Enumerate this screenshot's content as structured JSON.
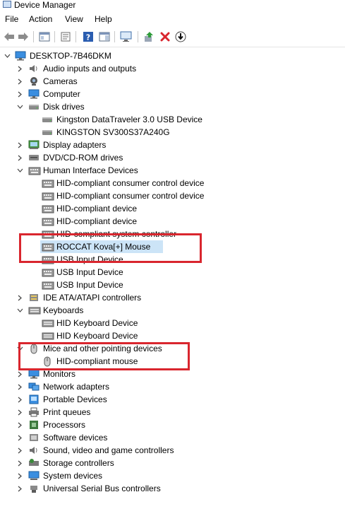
{
  "window": {
    "title": "Device Manager"
  },
  "menu": [
    "File",
    "Action",
    "View",
    "Help"
  ],
  "tree": {
    "root": "DESKTOP-7B46DKM",
    "categories": [
      {
        "label": "Audio inputs and outputs",
        "icon": "speaker-icon",
        "expanded": false,
        "children": []
      },
      {
        "label": "Cameras",
        "icon": "camera-icon",
        "expanded": false,
        "children": []
      },
      {
        "label": "Computer",
        "icon": "monitor-icon",
        "expanded": false,
        "children": []
      },
      {
        "label": "Disk drives",
        "icon": "drive-icon",
        "expanded": true,
        "children": [
          "Kingston DataTraveler 3.0 USB Device",
          "KINGSTON SV300S37A240G"
        ]
      },
      {
        "label": "Display adapters",
        "icon": "display-adapter-icon",
        "expanded": false,
        "children": []
      },
      {
        "label": "DVD/CD-ROM drives",
        "icon": "disc-icon",
        "expanded": false,
        "children": []
      },
      {
        "label": "Human Interface Devices",
        "icon": "hid-icon",
        "expanded": true,
        "children": [
          "HID-compliant consumer control device",
          "HID-compliant consumer control device",
          "HID-compliant device",
          "HID-compliant device",
          "HID-compliant system controller",
          "ROCCAT Kova[+] Mouse",
          "USB Input Device",
          "USB Input Device",
          "USB Input Device"
        ]
      },
      {
        "label": "IDE ATA/ATAPI controllers",
        "icon": "ide-icon",
        "expanded": false,
        "children": []
      },
      {
        "label": "Keyboards",
        "icon": "keyboard-icon",
        "expanded": true,
        "children": [
          "HID Keyboard Device",
          "HID Keyboard Device"
        ]
      },
      {
        "label": "Mice and other pointing devices",
        "icon": "mouse-icon",
        "expanded": true,
        "children": [
          "HID-compliant mouse"
        ]
      },
      {
        "label": "Monitors",
        "icon": "monitor-icon",
        "expanded": false,
        "children": []
      },
      {
        "label": "Network adapters",
        "icon": "network-icon",
        "expanded": false,
        "children": []
      },
      {
        "label": "Portable Devices",
        "icon": "portable-icon",
        "expanded": false,
        "children": []
      },
      {
        "label": "Print queues",
        "icon": "printer-icon",
        "expanded": false,
        "children": []
      },
      {
        "label": "Processors",
        "icon": "processor-icon",
        "expanded": false,
        "children": []
      },
      {
        "label": "Software devices",
        "icon": "software-icon",
        "expanded": false,
        "children": []
      },
      {
        "label": "Sound, video and game controllers",
        "icon": "sound-icon",
        "expanded": false,
        "children": []
      },
      {
        "label": "Storage controllers",
        "icon": "storage-icon",
        "expanded": false,
        "children": []
      },
      {
        "label": "System devices",
        "icon": "system-icon",
        "expanded": false,
        "children": []
      },
      {
        "label": "Universal Serial Bus controllers",
        "icon": "usb-icon",
        "expanded": false,
        "children": []
      }
    ]
  },
  "selected_item": "ROCCAT Kova[+] Mouse",
  "colors": {
    "highlight": "#d9262e",
    "selection": "#cce4f7",
    "accent": "#1e6fd0"
  }
}
